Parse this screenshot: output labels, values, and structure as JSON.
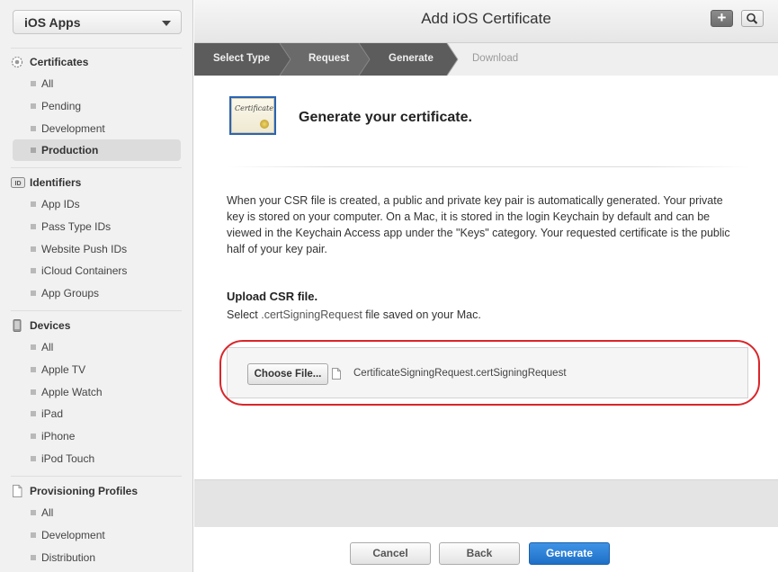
{
  "sidebar": {
    "app_selector": "iOS Apps",
    "sections": [
      {
        "title": "Certificates",
        "icon": "certificate-gear-icon",
        "items": [
          {
            "label": "All"
          },
          {
            "label": "Pending"
          },
          {
            "label": "Development"
          },
          {
            "label": "Production",
            "active": true
          }
        ]
      },
      {
        "title": "Identifiers",
        "icon": "id-badge-icon",
        "icon_text": "ID",
        "items": [
          {
            "label": "App IDs"
          },
          {
            "label": "Pass Type IDs"
          },
          {
            "label": "Website Push IDs"
          },
          {
            "label": "iCloud Containers"
          },
          {
            "label": "App Groups"
          }
        ]
      },
      {
        "title": "Devices",
        "icon": "device-phone-icon",
        "items": [
          {
            "label": "All"
          },
          {
            "label": "Apple TV"
          },
          {
            "label": "Apple Watch"
          },
          {
            "label": "iPad"
          },
          {
            "label": "iPhone"
          },
          {
            "label": "iPod Touch"
          }
        ]
      },
      {
        "title": "Provisioning Profiles",
        "icon": "document-icon",
        "items": [
          {
            "label": "All"
          },
          {
            "label": "Development"
          },
          {
            "label": "Distribution"
          }
        ]
      }
    ]
  },
  "header": {
    "title": "Add iOS Certificate",
    "add_icon": "plus-icon",
    "search_icon": "search-icon",
    "add_symbol": "+"
  },
  "steps": [
    {
      "label": "Select Type",
      "state": "done"
    },
    {
      "label": "Request",
      "state": "done"
    },
    {
      "label": "Generate",
      "state": "current"
    },
    {
      "label": "Download",
      "state": "upcoming"
    }
  ],
  "content": {
    "certificate_icon_text": "Certificate",
    "heading": "Generate your certificate.",
    "description": "When your CSR file is created, a public and private key pair is automatically generated. Your private key is stored on your computer. On a Mac, it is stored in the login Keychain by default and can be viewed in the Keychain Access app under the \"Keys\" category. Your requested certificate is the public half of your key pair.",
    "upload_title": "Upload CSR file.",
    "upload_sub_prefix": "Select ",
    "upload_sub_code": ".certSigningRequest",
    "upload_sub_suffix": " file saved on your Mac.",
    "choose_file_label": "Choose File...",
    "file_name": "CertificateSigningRequest.certSigningRequest",
    "highlight_color": "#d9262a"
  },
  "footer": {
    "cancel_label": "Cancel",
    "back_label": "Back",
    "generate_label": "Generate",
    "primary_color": "#1e70c7"
  }
}
